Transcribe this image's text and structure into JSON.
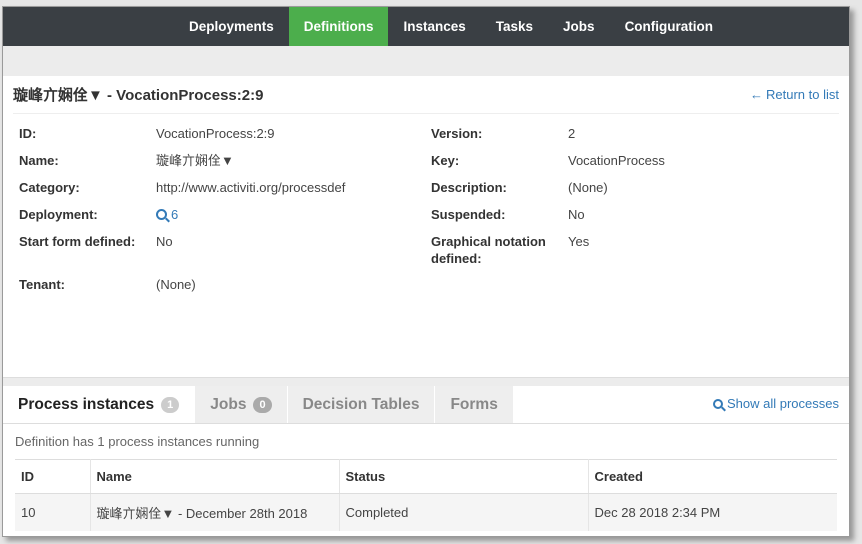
{
  "nav": {
    "items": [
      {
        "label": "Deployments",
        "active": false
      },
      {
        "label": "Definitions",
        "active": true
      },
      {
        "label": "Instances",
        "active": false
      },
      {
        "label": "Tasks",
        "active": false
      },
      {
        "label": "Jobs",
        "active": false
      },
      {
        "label": "Configuration",
        "active": false
      }
    ]
  },
  "header": {
    "title": "璇峰亣娴佺▼ - VocationProcess:2:9",
    "return_label": "Return to list",
    "return_arrow": "←"
  },
  "details": {
    "id_label": "ID:",
    "id_value": "VocationProcess:2:9",
    "name_label": "Name:",
    "name_value": "璇峰亣娴佺▼",
    "category_label": "Category:",
    "category_value": "http://www.activiti.org/processdef",
    "deployment_label": "Deployment:",
    "deployment_value": "6",
    "startform_label": "Start form defined:",
    "startform_value": "No",
    "tenant_label": "Tenant:",
    "tenant_value": "(None)",
    "version_label": "Version:",
    "version_value": "2",
    "key_label": "Key:",
    "key_value": "VocationProcess",
    "description_label": "Description:",
    "description_value": "(None)",
    "suspended_label": "Suspended:",
    "suspended_value": "No",
    "graphical_label": "Graphical notation defined:",
    "graphical_value": "Yes"
  },
  "tabs": {
    "items": [
      {
        "label": "Process instances",
        "badge": "1",
        "active": true
      },
      {
        "label": "Jobs",
        "badge": "0",
        "active": false
      },
      {
        "label": "Decision Tables",
        "badge": null,
        "active": false
      },
      {
        "label": "Forms",
        "badge": null,
        "active": false
      }
    ],
    "show_all_label": "Show all processes"
  },
  "instances": {
    "summary": "Definition has 1 process instances running",
    "columns": [
      "ID",
      "Name",
      "Status",
      "Created"
    ],
    "rows": [
      [
        "10",
        "璇峰亣娴佺▼ - December 28th 2018",
        "Completed",
        "Dec 28 2018 2:34 PM"
      ]
    ]
  },
  "colors": {
    "nav_bg": "#3a3f44",
    "nav_active": "#4cae4c",
    "link": "#337ab7"
  }
}
